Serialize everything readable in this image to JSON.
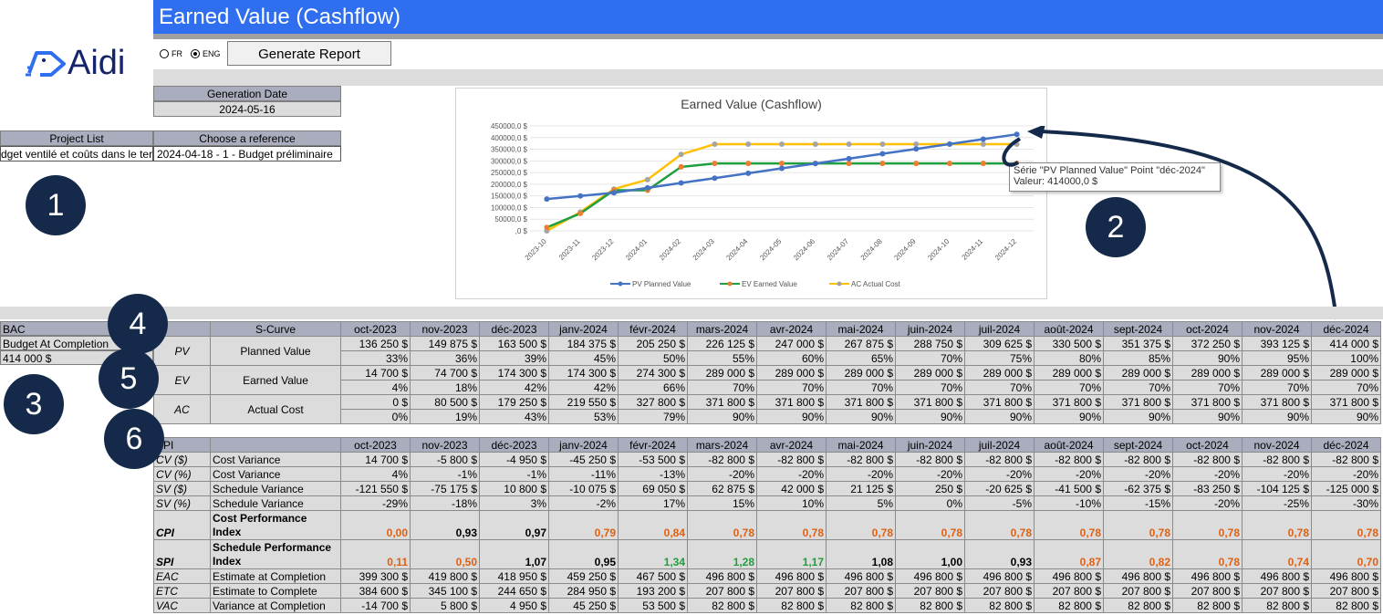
{
  "app": {
    "title": "Earned Value (Cashflow)",
    "logo_text": "Aidi"
  },
  "language": {
    "fr": "FR",
    "eng": "ENG",
    "selected": "ENG"
  },
  "generate_button": "Generate Report",
  "generation": {
    "label": "Generation Date",
    "value": "2024-05-16"
  },
  "project": {
    "list_label": "Project List",
    "list_value": "dget ventilé et coûts dans le ten",
    "ref_label": "Choose a reference",
    "ref_value": "2024-04-18 - 1 - Budget préliminaire"
  },
  "bac": {
    "label": "BAC",
    "desc": "Budget At Completion",
    "value": "414 000 $"
  },
  "markers": [
    "1",
    "2",
    "3",
    "4",
    "5",
    "6"
  ],
  "chart_data": {
    "type": "line",
    "title": "Earned Value (Cashflow)",
    "categories": [
      "2023-10",
      "2023-11",
      "2023-12",
      "2024-01",
      "2024-02",
      "2024-03",
      "2024-04",
      "2024-05",
      "2024-06",
      "2024-07",
      "2024-08",
      "2024-09",
      "2024-10",
      "2024-11",
      "2024-12"
    ],
    "yticks": [
      "450000,0 $",
      "400000,0 $",
      "350000,0 $",
      "300000,0 $",
      "250000,0 $",
      "200000,0 $",
      "150000,0 $",
      "100000,0 $",
      "50000,0 $",
      ",0 $"
    ],
    "ylim": [
      0,
      450000
    ],
    "series": [
      {
        "name": "PV Planned Value",
        "color": "#4472c4",
        "values": [
          136250,
          149875,
          163500,
          184375,
          205250,
          226125,
          247000,
          267875,
          288750,
          309625,
          330500,
          351375,
          372250,
          393125,
          414000
        ]
      },
      {
        "name": "EV Earned Value",
        "color": "#1e9e3e",
        "values": [
          14700,
          74700,
          174300,
          174300,
          274300,
          289000,
          289000,
          289000,
          289000,
          289000,
          289000,
          289000,
          289000,
          289000,
          289000
        ]
      },
      {
        "name": "AC Actual Cost",
        "color": "#ffc000",
        "values": [
          0,
          80500,
          179250,
          219550,
          327800,
          371800,
          371800,
          371800,
          371800,
          371800,
          371800,
          371800,
          371800,
          371800,
          371800
        ]
      }
    ],
    "legend": "bottom",
    "tooltip": {
      "line1": "Série \"PV Planned Value\" Point \"déc-2024\"",
      "line2": "Valeur: 414000,0 $"
    }
  },
  "months": [
    "oct-2023",
    "nov-2023",
    "déc-2023",
    "janv-2024",
    "févr-2024",
    "mars-2024",
    "avr-2024",
    "mai-2024",
    "juin-2024",
    "juil-2024",
    "août-2024",
    "sept-2024",
    "oct-2024",
    "nov-2024",
    "déc-2024"
  ],
  "scurve": {
    "header": "S-Curve",
    "rows": [
      {
        "code": "PV",
        "label": "Planned Value",
        "values": [
          "136 250 $",
          "149 875 $",
          "163 500 $",
          "184 375 $",
          "205 250 $",
          "226 125 $",
          "247 000 $",
          "267 875 $",
          "288 750 $",
          "309 625 $",
          "330 500 $",
          "351 375 $",
          "372 250 $",
          "393 125 $",
          "414 000 $"
        ],
        "pct": [
          "33%",
          "36%",
          "39%",
          "45%",
          "50%",
          "55%",
          "60%",
          "65%",
          "70%",
          "75%",
          "80%",
          "85%",
          "90%",
          "95%",
          "100%"
        ]
      },
      {
        "code": "EV",
        "label": "Earned Value",
        "values": [
          "14 700 $",
          "74 700 $",
          "174 300 $",
          "174 300 $",
          "274 300 $",
          "289 000 $",
          "289 000 $",
          "289 000 $",
          "289 000 $",
          "289 000 $",
          "289 000 $",
          "289 000 $",
          "289 000 $",
          "289 000 $",
          "289 000 $"
        ],
        "pct": [
          "4%",
          "18%",
          "42%",
          "42%",
          "66%",
          "70%",
          "70%",
          "70%",
          "70%",
          "70%",
          "70%",
          "70%",
          "70%",
          "70%",
          "70%"
        ]
      },
      {
        "code": "AC",
        "label": "Actual Cost",
        "values": [
          "0 $",
          "80 500 $",
          "179 250 $",
          "219 550 $",
          "327 800 $",
          "371 800 $",
          "371 800 $",
          "371 800 $",
          "371 800 $",
          "371 800 $",
          "371 800 $",
          "371 800 $",
          "371 800 $",
          "371 800 $",
          "371 800 $"
        ],
        "pct": [
          "0%",
          "19%",
          "43%",
          "53%",
          "79%",
          "90%",
          "90%",
          "90%",
          "90%",
          "90%",
          "90%",
          "90%",
          "90%",
          "90%",
          "90%"
        ]
      }
    ]
  },
  "kpi": {
    "header": "KPI",
    "rows": [
      {
        "code": "CV ($)",
        "label": "Cost Variance",
        "values": [
          "14 700 $",
          "-5 800 $",
          "-4 950 $",
          "-45 250 $",
          "-53 500 $",
          "-82 800 $",
          "-82 800 $",
          "-82 800 $",
          "-82 800 $",
          "-82 800 $",
          "-82 800 $",
          "-82 800 $",
          "-82 800 $",
          "-82 800 $",
          "-82 800 $"
        ]
      },
      {
        "code": "CV (%)",
        "label": "Cost Variance",
        "values": [
          "4%",
          "-1%",
          "-1%",
          "-11%",
          "-13%",
          "-20%",
          "-20%",
          "-20%",
          "-20%",
          "-20%",
          "-20%",
          "-20%",
          "-20%",
          "-20%",
          "-20%"
        ]
      },
      {
        "code": "SV ($)",
        "label": "Schedule Variance",
        "values": [
          "-121 550 $",
          "-75 175 $",
          "10 800 $",
          "-10 075 $",
          "69 050 $",
          "62 875 $",
          "42 000 $",
          "21 125 $",
          "250 $",
          "-20 625 $",
          "-41 500 $",
          "-62 375 $",
          "-83 250 $",
          "-104 125 $",
          "-125 000 $"
        ]
      },
      {
        "code": "SV (%)",
        "label": "Schedule Variance",
        "values": [
          "-29%",
          "-18%",
          "3%",
          "-2%",
          "17%",
          "15%",
          "10%",
          "5%",
          "0%",
          "-5%",
          "-10%",
          "-15%",
          "-20%",
          "-25%",
          "-30%"
        ]
      }
    ],
    "cpi": {
      "code": "CPI",
      "label": "Cost Performance Index",
      "values": [
        "0,00",
        "0,93",
        "0,97",
        "0,79",
        "0,84",
        "0,78",
        "0,78",
        "0,78",
        "0,78",
        "0,78",
        "0,78",
        "0,78",
        "0,78",
        "0,78",
        "0,78"
      ],
      "colors": [
        "#e06010",
        "#000000",
        "#000000",
        "#e06010",
        "#e06010",
        "#e06010",
        "#e06010",
        "#e06010",
        "#e06010",
        "#e06010",
        "#e06010",
        "#e06010",
        "#e06010",
        "#e06010",
        "#e06010"
      ]
    },
    "spi": {
      "code": "SPI",
      "label": "Schedule Performance Index",
      "values": [
        "0,11",
        "0,50",
        "1,07",
        "0,95",
        "1,34",
        "1,28",
        "1,17",
        "1,08",
        "1,00",
        "0,93",
        "0,87",
        "0,82",
        "0,78",
        "0,74",
        "0,70"
      ],
      "colors": [
        "#e06010",
        "#e06010",
        "#000000",
        "#000000",
        "#1e9e3e",
        "#1e9e3e",
        "#1e9e3e",
        "#000000",
        "#000000",
        "#000000",
        "#e06010",
        "#e06010",
        "#e06010",
        "#e06010",
        "#e06010"
      ]
    },
    "bottom_rows": [
      {
        "code": "EAC",
        "label": "Estimate at Completion",
        "values": [
          "399 300 $",
          "419 800 $",
          "418 950 $",
          "459 250 $",
          "467 500 $",
          "496 800 $",
          "496 800 $",
          "496 800 $",
          "496 800 $",
          "496 800 $",
          "496 800 $",
          "496 800 $",
          "496 800 $",
          "496 800 $",
          "496 800 $"
        ]
      },
      {
        "code": "ETC",
        "label": "Estimate to Complete",
        "values": [
          "384 600 $",
          "345 100 $",
          "244 650 $",
          "284 950 $",
          "193 200 $",
          "207 800 $",
          "207 800 $",
          "207 800 $",
          "207 800 $",
          "207 800 $",
          "207 800 $",
          "207 800 $",
          "207 800 $",
          "207 800 $",
          "207 800 $"
        ]
      },
      {
        "code": "VAC",
        "label": "Variance at Completion",
        "values": [
          "-14 700 $",
          "5 800 $",
          "4 950 $",
          "45 250 $",
          "53 500 $",
          "82 800 $",
          "82 800 $",
          "82 800 $",
          "82 800 $",
          "82 800 $",
          "82 800 $",
          "82 800 $",
          "82 800 $",
          "82 800 $",
          "82 800 $"
        ]
      }
    ]
  }
}
